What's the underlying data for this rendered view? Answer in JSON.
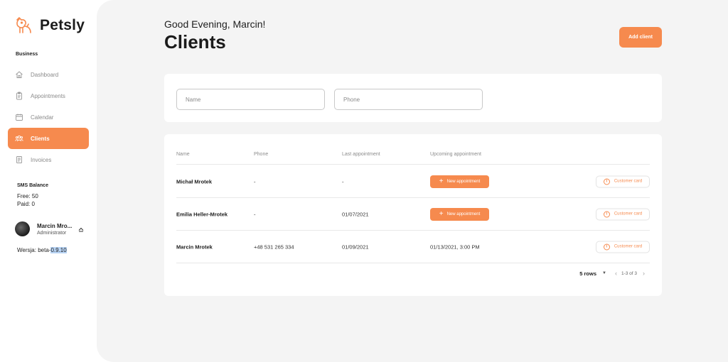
{
  "brand": {
    "name": "Petsly",
    "accent": "#f68a4e"
  },
  "sidebar": {
    "section_label": "Business",
    "items": [
      {
        "label": "Dashboard",
        "icon": "home-icon",
        "active": false
      },
      {
        "label": "Appointments",
        "icon": "clipboard-icon",
        "active": false
      },
      {
        "label": "Calendar",
        "icon": "calendar-icon",
        "active": false
      },
      {
        "label": "Clients",
        "icon": "users-icon",
        "active": true
      },
      {
        "label": "Invoices",
        "icon": "invoice-icon",
        "active": false
      }
    ],
    "sms": {
      "title": "SMS Balance",
      "free": "Free: 50",
      "paid": "Paid: 0"
    },
    "user": {
      "name": "Marcin Mro...",
      "role": "Administrator"
    },
    "version": {
      "prefix": "Wersja: beta-",
      "number": "0.9.10"
    }
  },
  "header": {
    "greeting": "Good Evening, Marcin!",
    "title": "Clients",
    "add_button": "Add client"
  },
  "filters": {
    "name_placeholder": "Name",
    "phone_placeholder": "Phone"
  },
  "table": {
    "columns": [
      "Name",
      "Phone",
      "Last appointment",
      "Upcoming appointment"
    ],
    "new_appointment_label": "New appointment",
    "customer_card_label": "Customer card",
    "rows": [
      {
        "name": "Michał Mrotek",
        "phone": "-",
        "last": "-",
        "upcoming": ""
      },
      {
        "name": "Emilia Heller-Mrotek",
        "phone": "-",
        "last": "01/07/2021",
        "upcoming": ""
      },
      {
        "name": "Marcin Mrotek",
        "phone": "+48 531 265 334",
        "last": "01/09/2021",
        "upcoming": "01/13/2021, 3:00 PM"
      }
    ]
  },
  "pagination": {
    "rows_per_page": "5 rows",
    "range": "1-3 of 3"
  }
}
